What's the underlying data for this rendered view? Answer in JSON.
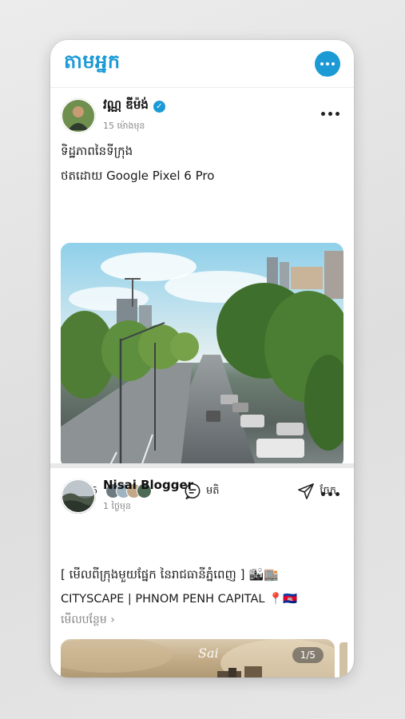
{
  "header": {
    "title": "តាមអ្នក",
    "messenger_icon": "chat-bubble-dots-icon",
    "accent": "#1c9ad6"
  },
  "posts": [
    {
      "author": "វណ្ណ ឌីម៉ង់",
      "verified": true,
      "time": "15 ម៉ោងមុន",
      "caption_line1": "ទិដ្ឋភាពនៃទីក្រុង",
      "caption_line2": "ថតដោយ Google Pixel 6 Pro",
      "likes": "65",
      "comment_label": "មតិ",
      "share_label": "ចែក"
    },
    {
      "author": "Nisai Blogger",
      "time": "1 ថ្ងៃមុន",
      "caption_line1": "[ មើលពីក្រុងមួយផ្នែក នៃរាជធានីភ្នំពេញ ] 🏙🏬",
      "caption_line2": "CITYSCAPE | PHNOM PENH CAPITAL 📍🇰🇭",
      "see_more": "មើលបន្ថែម ›",
      "image_pager": "1/5",
      "image_signature": "Sai"
    }
  ]
}
